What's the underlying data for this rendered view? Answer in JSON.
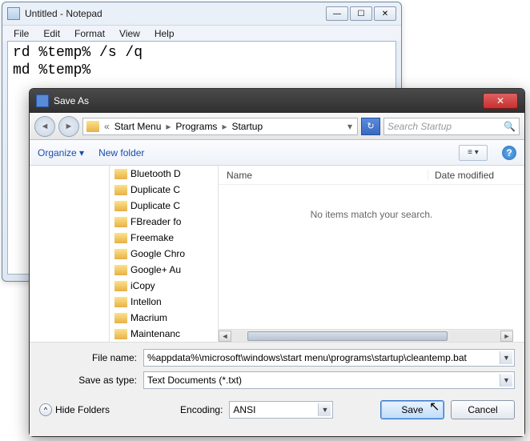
{
  "notepad": {
    "title": "Untitled - Notepad",
    "menu": {
      "file": "File",
      "edit": "Edit",
      "format": "Format",
      "view": "View",
      "help": "Help"
    },
    "content": "rd %temp% /s /q\nmd %temp%"
  },
  "saveas": {
    "title": "Save As",
    "nav": {
      "breadcrumb": [
        "Start Menu",
        "Programs",
        "Startup"
      ],
      "search_placeholder": "Search Startup"
    },
    "toolbar": {
      "organize": "Organize ▾",
      "newfolder": "New folder"
    },
    "folders": [
      "Bluetooth D",
      "Duplicate C",
      "Duplicate C",
      "FBreader fo",
      "Freemake",
      "Google Chro",
      "Google+ Au",
      "iCopy",
      "Intellon",
      "Macrium",
      "Maintenanc"
    ],
    "list": {
      "col_name": "Name",
      "col_date": "Date modified",
      "empty": "No items match your search."
    },
    "filename_label": "File name:",
    "filename_value": "%appdata%\\microsoft\\windows\\start menu\\programs\\startup\\cleantemp.bat",
    "type_label": "Save as type:",
    "type_value": "Text Documents (*.txt)",
    "encoding_label": "Encoding:",
    "encoding_value": "ANSI",
    "hide_folders": "Hide Folders",
    "save": "Save",
    "cancel": "Cancel"
  }
}
